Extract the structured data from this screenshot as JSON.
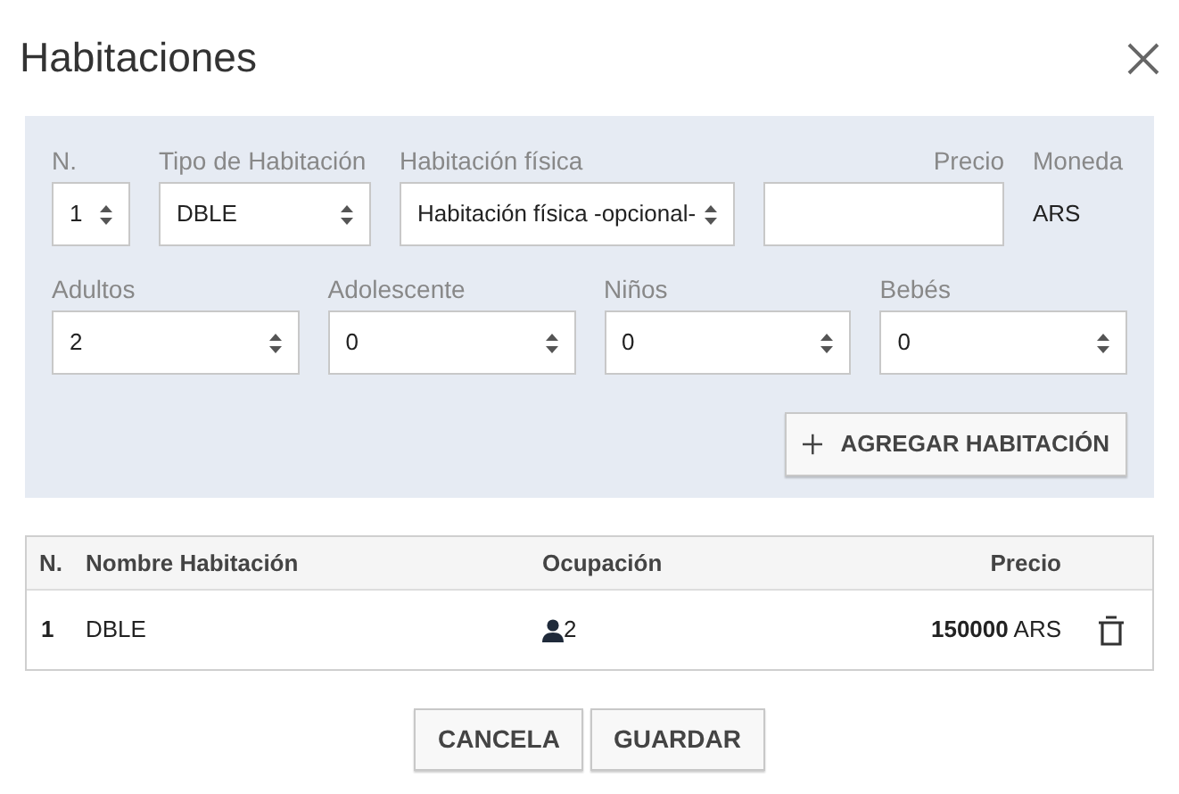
{
  "title": "Habitaciones",
  "form": {
    "row_1": [
      {
        "kind": "select",
        "label": "N.",
        "value": "1"
      },
      {
        "kind": "select",
        "label": "Tipo de Habitación",
        "value": "DBLE"
      },
      {
        "kind": "select",
        "label": "Habitación física",
        "value": "Habitación física -opcional-"
      },
      {
        "kind": "input",
        "label": "Precio"
      },
      {
        "kind": "text",
        "label": "Moneda",
        "value": "ARS"
      }
    ],
    "row_2": [
      {
        "kind": "select",
        "label": "Adultos",
        "value": "2"
      },
      {
        "kind": "select",
        "label": "Adolescente",
        "value": "0"
      },
      {
        "kind": "select",
        "label": "Niños",
        "value": "0"
      },
      {
        "kind": "select",
        "label": "Bebés",
        "value": "0"
      }
    ],
    "add_button": "AGREGAR HABITACIÓN"
  },
  "table": {
    "columns": [
      "N.",
      "Nombre Habitación",
      "Ocupación",
      "Precio"
    ],
    "rows": [
      {
        "n": "1",
        "name": "DBLE",
        "occupancy": "2",
        "price": "**150000** ARS"
      }
    ]
  },
  "buttons": [
    "CANCELA",
    "GUARDAR"
  ]
}
